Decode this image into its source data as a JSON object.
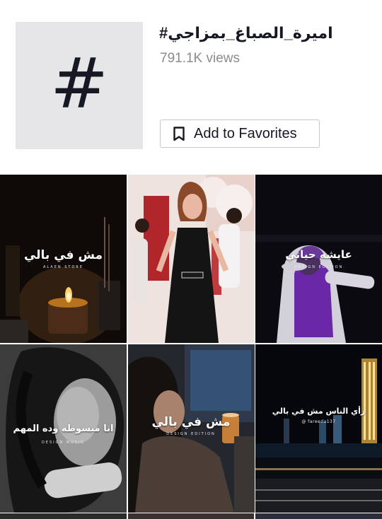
{
  "header": {
    "hashtag_symbol": "#",
    "title": "#اميرة_الصباغ_بمزاجي",
    "views": "791.1K views",
    "favorite_button_label": "Add to Favorites"
  },
  "grid": {
    "tiles": [
      {
        "overlay_text": "مش في بالي",
        "sub_text": "ALAEN STORE"
      },
      {
        "overlay_text": "",
        "sub_text": ""
      },
      {
        "overlay_text": "عايشه حياتي",
        "sub_text": "DESIGN EDITION"
      },
      {
        "overlay_text": "انا مبسوطه وده المهم",
        "sub_text": "DESIGN MUSIC"
      },
      {
        "overlay_text": "مش في بالي",
        "sub_text": "DESIGN EDITION"
      },
      {
        "overlay_text": "رأي الناس مش في بالي",
        "sub_text": "@ fareeda137"
      }
    ]
  },
  "colors": {
    "text_primary": "#161823",
    "text_secondary": "#8a8b91",
    "tile_placeholder": "#e6e6e8",
    "button_border": "#c7c7ca"
  },
  "icons": {
    "bookmark": "bookmark-icon",
    "hashtag": "hashtag-icon",
    "candle": "candle-icon"
  }
}
